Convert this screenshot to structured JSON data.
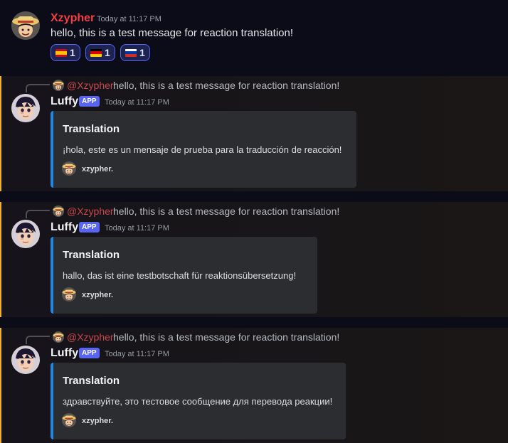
{
  "top_message": {
    "username": "Xzypher",
    "username_color": "#f23f43",
    "timestamp": "Today at 11:17 PM",
    "text": "hello, this is a test message for reaction translation!",
    "reactions": [
      {
        "emoji": "flag-es",
        "count": "1"
      },
      {
        "emoji": "flag-de",
        "count": "1"
      },
      {
        "emoji": "flag-ru",
        "count": "1"
      }
    ]
  },
  "bot_messages": [
    {
      "reply_mention": "@Xzypher",
      "reply_text": "hello, this is a test message for reaction translation!",
      "username": "Luffy",
      "badge": "APP",
      "timestamp": "Today at 11:17 PM",
      "embed_title": "Translation",
      "embed_description": "¡hola, este es un mensaje de prueba para la traducción de reacción!",
      "embed_footer": "xzypher."
    },
    {
      "reply_mention": "@Xzypher",
      "reply_text": "hello, this is a test message for reaction translation!",
      "username": "Luffy",
      "badge": "APP",
      "timestamp": "Today at 11:17 PM",
      "embed_title": "Translation",
      "embed_description": "hallo, das ist eine testbotschaft für reaktionsübersetzung!",
      "embed_footer": "xzypher."
    },
    {
      "reply_mention": "@Xzypher",
      "reply_text": "hello, this is a test message for reaction translation!",
      "username": "Luffy",
      "badge": "APP",
      "timestamp": "Today at 11:17 PM",
      "embed_title": "Translation",
      "embed_description": "здравствуйте, это тестовое сообщение для перевода реакции!",
      "embed_footer": "xzypher."
    }
  ],
  "colors": {
    "embed_accent": "#1e88e5",
    "reaction_border": "#5865f2",
    "mention": "#c9484b",
    "app_badge": "#5865f2",
    "highlight_bar": "#f0b232"
  }
}
